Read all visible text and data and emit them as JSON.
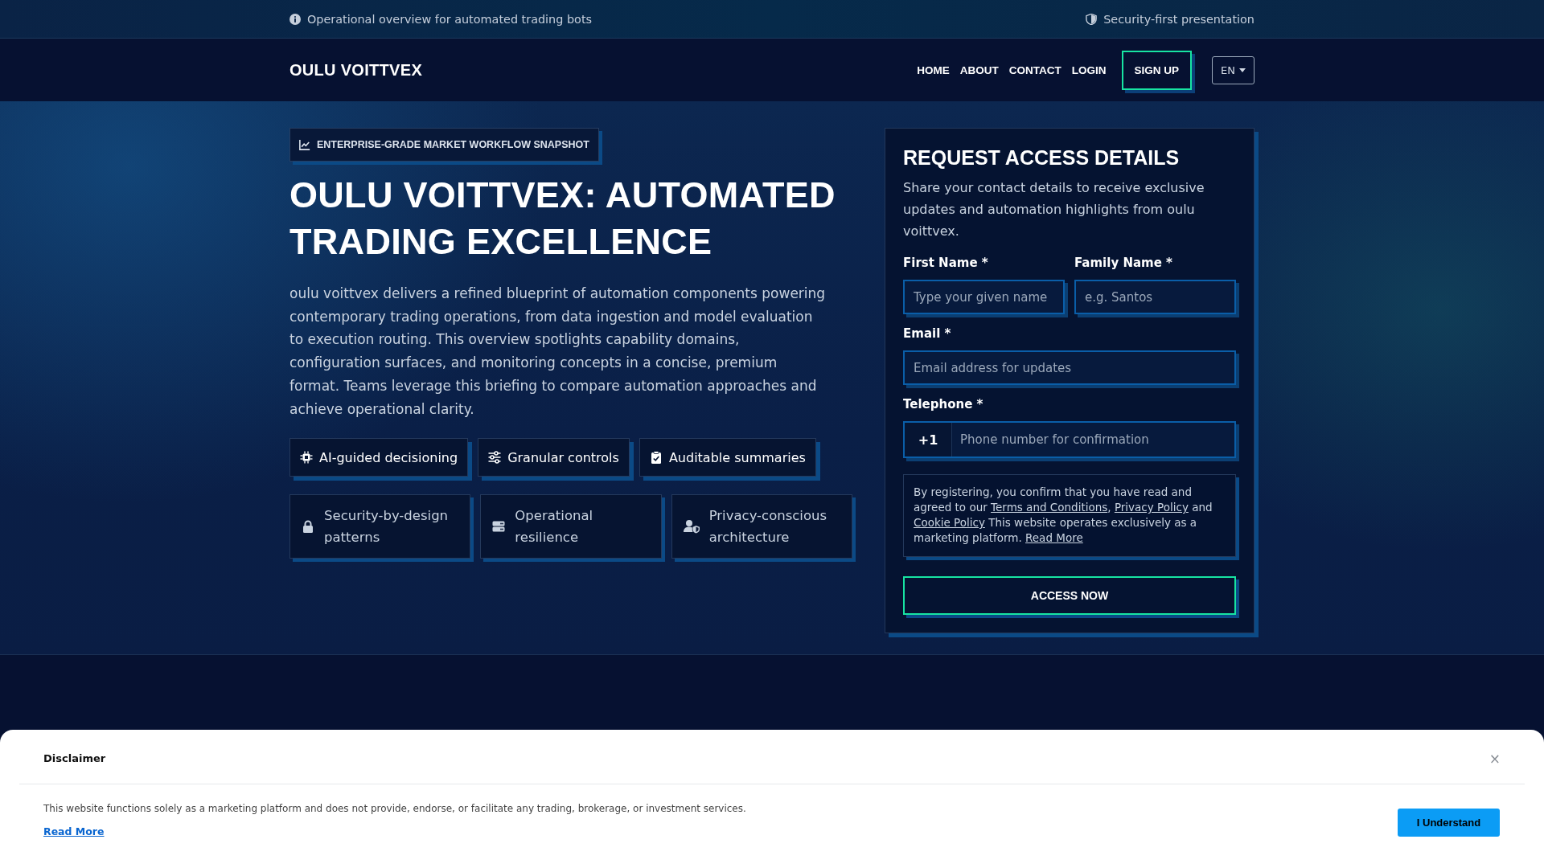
{
  "top_bar": {
    "left_text": "Operational overview for automated trading bots",
    "right_text": "Security-first presentation"
  },
  "nav": {
    "logo": "OULU VOITTVEX",
    "links": [
      {
        "label": "HOME",
        "kind": "link"
      },
      {
        "label": "ABOUT",
        "kind": "link"
      },
      {
        "label": "CONTACT",
        "kind": "link"
      },
      {
        "label": "LOGIN",
        "kind": "link"
      },
      {
        "label": "SIGN UP",
        "kind": "button"
      }
    ],
    "language": "EN"
  },
  "hero": {
    "badge": "ENTERPRISE-GRADE MARKET WORKFLOW SNAPSHOT",
    "title": "OULU VOITTVEX: AUTOMATED TRADING EXCELLENCE",
    "description": "oulu voittvex delivers a refined blueprint of automation components powering contemporary trading operations, from data ingestion and model evaluation to execution routing. This overview spotlights capability domains, configuration surfaces, and monitoring concepts in a concise, premium format. Teams leverage this briefing to compare automation approaches and achieve operational clarity.",
    "highlights": [
      "AI-guided decisioning",
      "Granular controls",
      "Auditable summaries"
    ],
    "features": [
      "Security-by-design patterns",
      "Operational resilience",
      "Privacy-conscious architecture"
    ]
  },
  "form": {
    "title": "REQUEST ACCESS DETAILS",
    "description": "Share your contact details to receive exclusive updates and automation highlights from oulu voittvex.",
    "rows": [
      [
        {
          "label": "First Name *",
          "placeholder": "Type your given name",
          "kind": "text"
        },
        {
          "label": "Family Name *",
          "placeholder": "e.g. Santos",
          "kind": "text"
        }
      ],
      [
        {
          "label": "Email *",
          "placeholder": "Email address for updates",
          "kind": "text"
        }
      ],
      [
        {
          "label": "Telephone *",
          "placeholder": "Phone number for confirmation",
          "kind": "phone",
          "prefix": "+1"
        }
      ]
    ],
    "consent": [
      {
        "kind": "text",
        "text": "By registering, you confirm that you have read and agreed to our "
      },
      {
        "kind": "link",
        "text": "Terms and Conditions"
      },
      {
        "kind": "text",
        "text": ", "
      },
      {
        "kind": "link",
        "text": "Privacy Policy"
      },
      {
        "kind": "text",
        "text": " and "
      },
      {
        "kind": "link",
        "text": "Cookie Policy"
      },
      {
        "kind": "text",
        "text": " This website operates exclusively as a marketing platform. "
      },
      {
        "kind": "link",
        "text": "Read More"
      }
    ],
    "submit": "ACCESS NOW"
  },
  "disclaimer": {
    "title": "Disclaimer",
    "close": "×",
    "text": "This website functions solely as a marketing platform and does not provide, endorse, or facilitate any trading, brokerage, or investment services.",
    "link": "Read More",
    "button": "I Understand"
  }
}
